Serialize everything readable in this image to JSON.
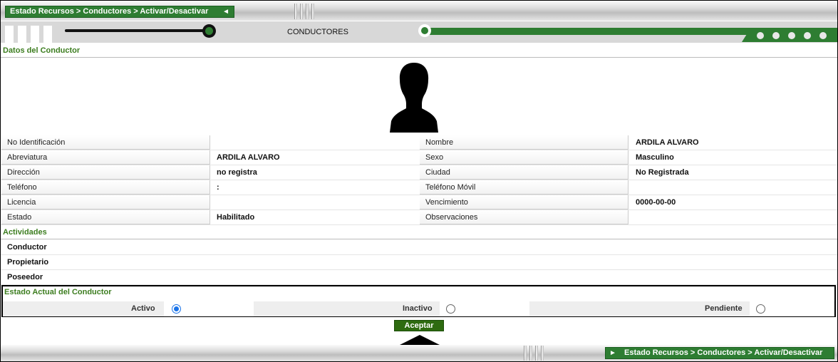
{
  "breadcrumb": {
    "text": "Estado Recursos > Conductores > Activar/Desactivar"
  },
  "header": {
    "title": "CONDUCTORES"
  },
  "sections": {
    "datos": "Datos del Conductor",
    "actividades": "Actividades",
    "estado": "Estado Actual del Conductor"
  },
  "fields": [
    {
      "left_label": "No Identificación",
      "left_value": "",
      "right_label": "Nombre",
      "right_value": "ARDILA ALVARO"
    },
    {
      "left_label": "Abreviatura",
      "left_value": "ARDILA ALVARO",
      "right_label": "Sexo",
      "right_value": "Masculino"
    },
    {
      "left_label": "Dirección",
      "left_value": "no registra",
      "right_label": "Ciudad",
      "right_value": "No Registrada"
    },
    {
      "left_label": "Teléfono",
      "left_value": ":",
      "right_label": "Teléfono Móvil",
      "right_value": ""
    },
    {
      "left_label": "Licencia",
      "left_value": "",
      "right_label": "Vencimiento",
      "right_value": "0000-00-00"
    },
    {
      "left_label": "Estado",
      "left_value": "Habilitado",
      "right_label": "Observaciones",
      "right_value": ""
    }
  ],
  "actividades": [
    "Conductor",
    "Propietario",
    "Poseedor"
  ],
  "estado_options": [
    {
      "label": "Activo",
      "selected": true
    },
    {
      "label": "Inactivo",
      "selected": false
    },
    {
      "label": "Pendiente",
      "selected": false
    }
  ],
  "buttons": {
    "accept": "Aceptar"
  },
  "icons": {
    "crumb_arrow": "triangle-left-icon",
    "bottom_crumb_arrow": "triangle-right-icon",
    "photo": "person-silhouette-icon",
    "pointer": "arrow-up-icon"
  },
  "colors": {
    "accent": "#2e7d32",
    "section_text": "#3c7d1f",
    "radio_selected": "#1a73e8"
  }
}
